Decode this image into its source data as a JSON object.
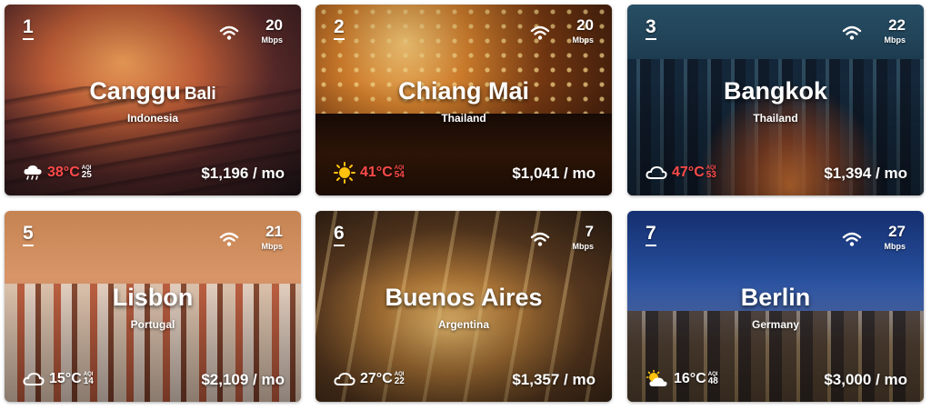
{
  "cards": [
    {
      "rank": "1",
      "city": "Canggu",
      "region": "Bali",
      "country": "Indonesia",
      "wifi_speed": "20",
      "wifi_unit": "Mbps",
      "weather_icon": "rain-cloud-icon",
      "temp": "38°C",
      "temp_hot": true,
      "aqi_label": "AQI",
      "aqi_value": "25",
      "aqi_bad": false,
      "price": "$1,196 / mo"
    },
    {
      "rank": "2",
      "city": "Chiang Mai",
      "region": "",
      "country": "Thailand",
      "wifi_speed": "20",
      "wifi_unit": "Mbps",
      "weather_icon": "sun-icon",
      "temp": "41°C",
      "temp_hot": true,
      "aqi_label": "AQI",
      "aqi_value": "54",
      "aqi_bad": true,
      "price": "$1,041 / mo"
    },
    {
      "rank": "3",
      "city": "Bangkok",
      "region": "",
      "country": "Thailand",
      "wifi_speed": "22",
      "wifi_unit": "Mbps",
      "weather_icon": "cloud-icon",
      "temp": "47°C",
      "temp_hot": true,
      "aqi_label": "AQI",
      "aqi_value": "53",
      "aqi_bad": true,
      "price": "$1,394 / mo"
    },
    {
      "rank": "5",
      "city": "Lisbon",
      "region": "",
      "country": "Portugal",
      "wifi_speed": "21",
      "wifi_unit": "Mbps",
      "weather_icon": "cloud-icon",
      "temp": "15°C",
      "temp_hot": false,
      "aqi_label": "AQI",
      "aqi_value": "14",
      "aqi_bad": false,
      "price": "$2,109 / mo"
    },
    {
      "rank": "6",
      "city": "Buenos Aires",
      "region": "",
      "country": "Argentina",
      "wifi_speed": "7",
      "wifi_unit": "Mbps",
      "weather_icon": "cloud-icon",
      "temp": "27°C",
      "temp_hot": false,
      "aqi_label": "AQI",
      "aqi_value": "22",
      "aqi_bad": false,
      "price": "$1,357 / mo"
    },
    {
      "rank": "7",
      "city": "Berlin",
      "region": "",
      "country": "Germany",
      "wifi_speed": "27",
      "wifi_unit": "Mbps",
      "weather_icon": "partly-cloudy-icon",
      "temp": "16°C",
      "temp_hot": false,
      "aqi_label": "AQI",
      "aqi_value": "48",
      "aqi_bad": false,
      "price": "$3,000 / mo"
    }
  ],
  "colors": {
    "hot_temp": "#ff4a4a",
    "bad_aqi": "#ff4a4a",
    "sun": "#ffc20e"
  }
}
